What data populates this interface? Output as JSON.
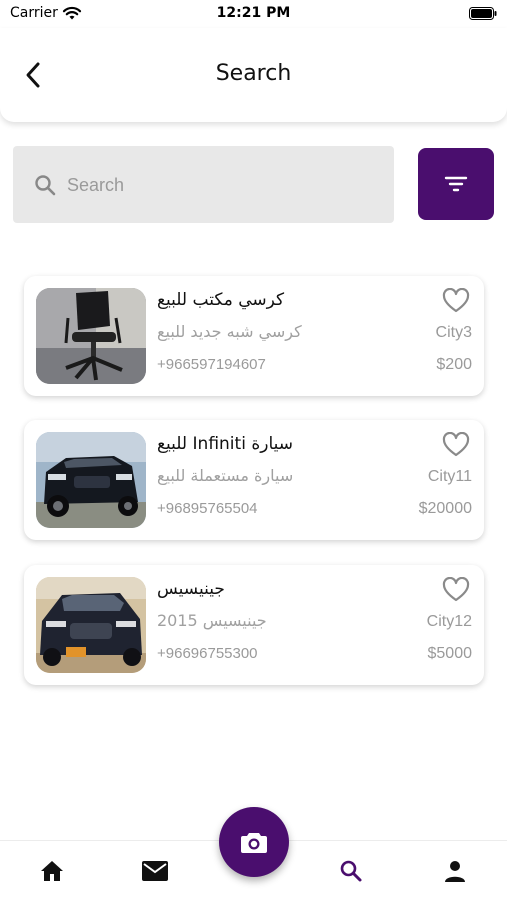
{
  "status_bar": {
    "carrier": "Carrier",
    "time": "12:21 PM"
  },
  "header": {
    "title": "Search",
    "back_icon": "chevron-left-icon"
  },
  "search": {
    "placeholder": "Search",
    "value": "",
    "icon": "search-icon"
  },
  "filter": {
    "icon": "filter-icon",
    "color": "#4a0e6e"
  },
  "listings": [
    {
      "title": "كرسي مكتب للبيع",
      "subtitle": "كرسي شبه جديد للبيع",
      "phone": "+966597194607",
      "city": "City3",
      "price": "$200",
      "image": "office-chair-photo"
    },
    {
      "title": "للبيع Infiniti سيارة",
      "subtitle": "سيارة مستعملة للبيع",
      "phone": "+96895765504",
      "city": "City11",
      "price": "$20000",
      "image": "infiniti-suv-photo"
    },
    {
      "title": "جينيسيس",
      "subtitle": "جينيسيس 2015",
      "phone": "+96696755300",
      "city": "City12",
      "price": "$5000",
      "image": "genesis-sedan-photo"
    }
  ],
  "tab_bar": {
    "items": [
      "home-icon",
      "mail-icon",
      "search-icon",
      "user-icon"
    ],
    "active": "search-icon",
    "fab_icon": "camera-icon"
  },
  "colors": {
    "accent": "#4a0e6e",
    "muted_text": "#9a9a9a",
    "search_bg": "#e8e8e8"
  }
}
